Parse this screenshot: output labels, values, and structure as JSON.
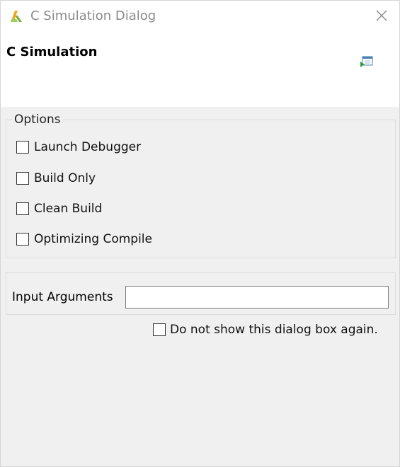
{
  "window": {
    "title": "C Simulation Dialog"
  },
  "header": {
    "title": "C Simulation",
    "icon": "run-simulation-icon"
  },
  "options": {
    "legend": "Options",
    "items": [
      {
        "label": "Launch Debugger",
        "checked": false
      },
      {
        "label": "Build Only",
        "checked": false
      },
      {
        "label": "Clean Build",
        "checked": false
      },
      {
        "label": "Optimizing Compile",
        "checked": false
      }
    ]
  },
  "input_arguments": {
    "label": "Input Arguments",
    "value": "",
    "placeholder": ""
  },
  "dont_show": {
    "label": "Do not show this dialog box again.",
    "checked": false
  },
  "colors": {
    "app_icon_primary": "#7cb342",
    "app_icon_secondary": "#f5a623",
    "title_text": "#8a8a8a",
    "dialog_background": "#f0f0f0"
  }
}
